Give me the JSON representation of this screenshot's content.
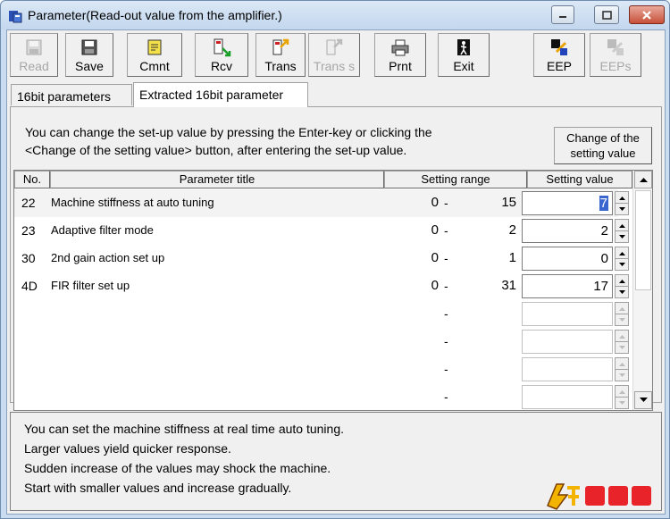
{
  "window": {
    "title": "Parameter(Read-out value from the amplifier.)",
    "controls": [
      "minimize",
      "maximize",
      "close"
    ]
  },
  "toolbar": {
    "buttons": [
      {
        "label": "Read",
        "icon": "disk-icon",
        "enabled": false
      },
      {
        "label": "Save",
        "icon": "disk-icon",
        "enabled": true
      },
      {
        "label": "Cmnt",
        "icon": "note-icon",
        "enabled": true
      },
      {
        "label": "Rcv",
        "icon": "receive-icon",
        "enabled": true
      },
      {
        "label": "Trans",
        "icon": "transfer-icon",
        "enabled": true
      },
      {
        "label": "Trans s",
        "icon": "transfer-selected-icon",
        "enabled": false
      },
      {
        "label": "Prnt",
        "icon": "printer-icon",
        "enabled": true
      },
      {
        "label": "Exit",
        "icon": "exit-door-icon",
        "enabled": true
      },
      {
        "label": "EEP",
        "icon": "eeprom-write-icon",
        "enabled": true
      },
      {
        "label": "EEPs",
        "icon": "eeprom-selected-icon",
        "enabled": false
      }
    ]
  },
  "tabs": [
    {
      "label": "16bit parameters",
      "active": false
    },
    {
      "label": "Extracted 16bit parameter",
      "active": true
    }
  ],
  "instruction": {
    "line1": "You can change the set-up value by pressing the Enter-key or clicking the",
    "line2": "<Change of the setting value> button, after entering the set-up value."
  },
  "change_button": {
    "line1": "Change of the",
    "line2": "setting value"
  },
  "table": {
    "headers": {
      "no": "No.",
      "title": "Parameter title",
      "range": "Setting range",
      "value": "Setting value"
    },
    "rows": [
      {
        "no": "22",
        "title": "Machine stiffness at auto tuning",
        "min": "0",
        "dash": "-",
        "max": "15",
        "value": "7",
        "selected": true
      },
      {
        "no": "23",
        "title": "Adaptive filter mode",
        "min": "0",
        "dash": "-",
        "max": "2",
        "value": "2"
      },
      {
        "no": "30",
        "title": "2nd gain action set up",
        "min": "0",
        "dash": "-",
        "max": "1",
        "value": "0"
      },
      {
        "no": "4D",
        "title": "FIR filter set up",
        "min": "0",
        "dash": "-",
        "max": "31",
        "value": "17"
      },
      {
        "no": "",
        "title": "",
        "min": "",
        "dash": "-",
        "max": "",
        "value": ""
      },
      {
        "no": "",
        "title": "",
        "min": "",
        "dash": "-",
        "max": "",
        "value": ""
      },
      {
        "no": "",
        "title": "",
        "min": "",
        "dash": "-",
        "max": "",
        "value": ""
      },
      {
        "no": "",
        "title": "",
        "min": "",
        "dash": "-",
        "max": "",
        "value": ""
      }
    ]
  },
  "description": {
    "lines": [
      "You can set the machine stiffness at real time auto tuning.",
      "Larger values yield quicker response.",
      "Sudden increase of the values may shock the machine.",
      "Start with smaller values and increase gradually."
    ]
  },
  "colors": {
    "selection": "#3a66cf",
    "titlebar": "#c9dcf0",
    "close_button": "#c75039"
  }
}
